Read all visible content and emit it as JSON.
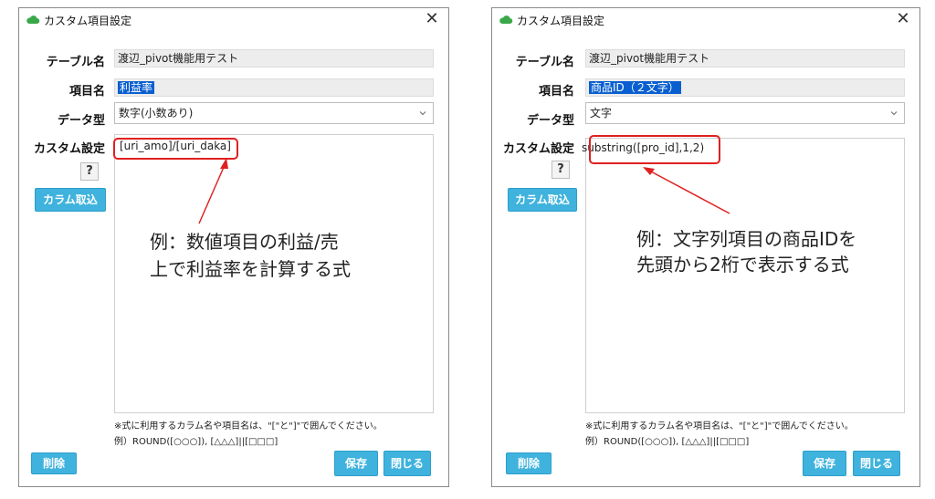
{
  "dialogs": [
    {
      "title": "カスタム項目設定",
      "table_label": "テーブル名",
      "table_value": "渡辺_pivot機能用テスト",
      "item_label": "項目名",
      "item_value": "利益率",
      "type_label": "データ型",
      "type_value": "数字(小数あり)",
      "custom_label": "カスタム設定",
      "help_label": "?",
      "column_button": "カラム取込",
      "formula": "[uri_amo]/[uri_daka]",
      "note_line1": "※式に利用するカラム名や項目名は、\"[\"と\"]\"で囲んでください。",
      "note_line2": "例）ROUND([○○○]), [△△△]||[□□□]",
      "delete_button": "削除",
      "save_button": "保存",
      "close_button": "閉じる",
      "annotation_line1": "例：数値項目の利益/売",
      "annotation_line2": "上で利益率を計算する式"
    },
    {
      "title": "カスタム項目設定",
      "table_label": "テーブル名",
      "table_value": "渡辺_pivot機能用テスト",
      "item_label": "項目名",
      "item_value": "商品ID（２文字）",
      "type_label": "データ型",
      "type_value": "文字",
      "custom_label": "カスタム設定",
      "help_label": "?",
      "column_button": "カラム取込",
      "formula": "substring([pro_id],1,2)",
      "note_line1": "※式に利用するカラム名や項目名は、\"[\"と\"]\"で囲んでください。",
      "note_line2": "例）ROUND([○○○]), [△△△]||[□□□]",
      "delete_button": "削除",
      "save_button": "保存",
      "close_button": "閉じる",
      "annotation_line1": "例：文字列項目の商品IDを",
      "annotation_line2": "先頭から2桁で表示する式"
    }
  ],
  "colors": {
    "accent": "#3fb3dd",
    "callout": "#e02020",
    "selection": "#0a5fd0",
    "cloud_icon": "#3aa84a"
  },
  "icons": {
    "app": "cloud-icon",
    "close": "close-icon",
    "dropdown": "chevron-down-icon"
  }
}
